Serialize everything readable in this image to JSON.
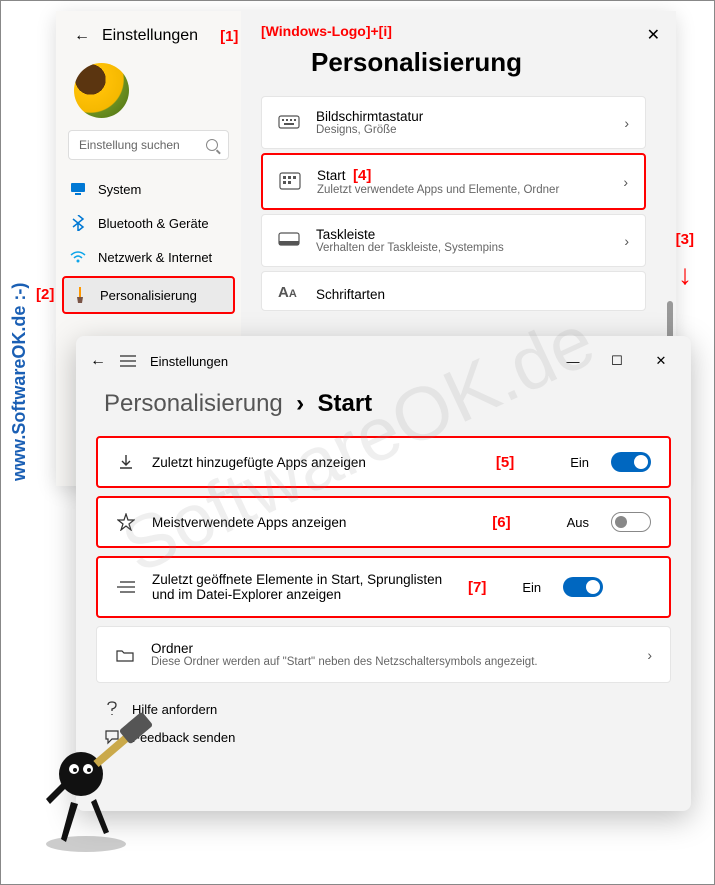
{
  "watermark": "SoftwareOK.de",
  "vertical_text": "www.SoftwareOK.de :-)",
  "callouts": {
    "c1": "[1]",
    "c2": "[2]",
    "c3": "[3]",
    "c4": "[4]",
    "c5": "[5]",
    "c6": "[6]",
    "c7": "[7]"
  },
  "window1": {
    "back": "←",
    "title": "Einstellungen",
    "search_placeholder": "Einstellung suchen",
    "hotkey": "[Windows-Logo]+[i]",
    "page_title": "Personalisierung",
    "nav": [
      {
        "label": "System",
        "icon": "monitor"
      },
      {
        "label": "Bluetooth & Geräte",
        "icon": "bluetooth"
      },
      {
        "label": "Netzwerk & Internet",
        "icon": "wifi"
      },
      {
        "label": "Personalisierung",
        "icon": "brush",
        "selected": true
      }
    ],
    "cards": [
      {
        "title": "Bildschirmtastatur",
        "sub": "Designs, Größe",
        "icon": "keyboard"
      },
      {
        "title": "Start",
        "sub": "Zuletzt verwendete Apps und Elemente, Ordner",
        "icon": "start",
        "highlight": true,
        "callout": "[4]"
      },
      {
        "title": "Taskleiste",
        "sub": "Verhalten der Taskleiste, Systempins",
        "icon": "taskbar"
      },
      {
        "title": "Schriftarten",
        "sub": "",
        "icon": "fonts"
      }
    ]
  },
  "window2": {
    "title": "Einstellungen",
    "bc_parent": "Personalisierung",
    "bc_sep": "›",
    "bc_current": "Start",
    "rows": [
      {
        "label": "Zuletzt hinzugefügte Apps anzeigen",
        "state": "Ein",
        "on": true,
        "icon": "download",
        "callout": "[5]"
      },
      {
        "label": "Meistverwendete Apps anzeigen",
        "state": "Aus",
        "on": false,
        "icon": "star",
        "callout": "[6]"
      },
      {
        "label": "Zuletzt geöffnete Elemente in Start, Sprunglisten und im Datei-Explorer anzeigen",
        "state": "Ein",
        "on": true,
        "icon": "list",
        "callout": "[7]"
      }
    ],
    "folders": {
      "title": "Ordner",
      "sub": "Diese Ordner werden auf \"Start\" neben des Netzschaltersymbols angezeigt."
    },
    "footer": {
      "help": "Hilfe anfordern",
      "feedback": "Feedback senden"
    }
  }
}
